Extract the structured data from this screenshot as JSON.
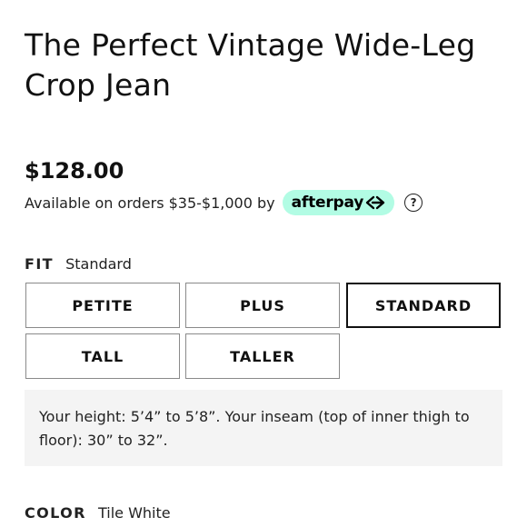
{
  "product": {
    "title": "The Perfect Vintage Wide-Leg Crop Jean",
    "price": "$128.00"
  },
  "payment": {
    "availability_text": "Available on orders $35-$1,000 by",
    "afterpay_label": "afterpay",
    "help_label": "?",
    "afterpay_color": "#b2fce4"
  },
  "fit": {
    "label": "FIT",
    "selected_value": "Standard",
    "options": [
      "PETITE",
      "PLUS",
      "STANDARD",
      "TALL",
      "TALLER"
    ],
    "selected_index": 2,
    "info": "Your height: 5’4” to 5’8”. Your inseam (top of inner thigh to floor): 30” to 32”."
  },
  "color": {
    "label": "COLOR",
    "selected_value": "Tile White"
  }
}
